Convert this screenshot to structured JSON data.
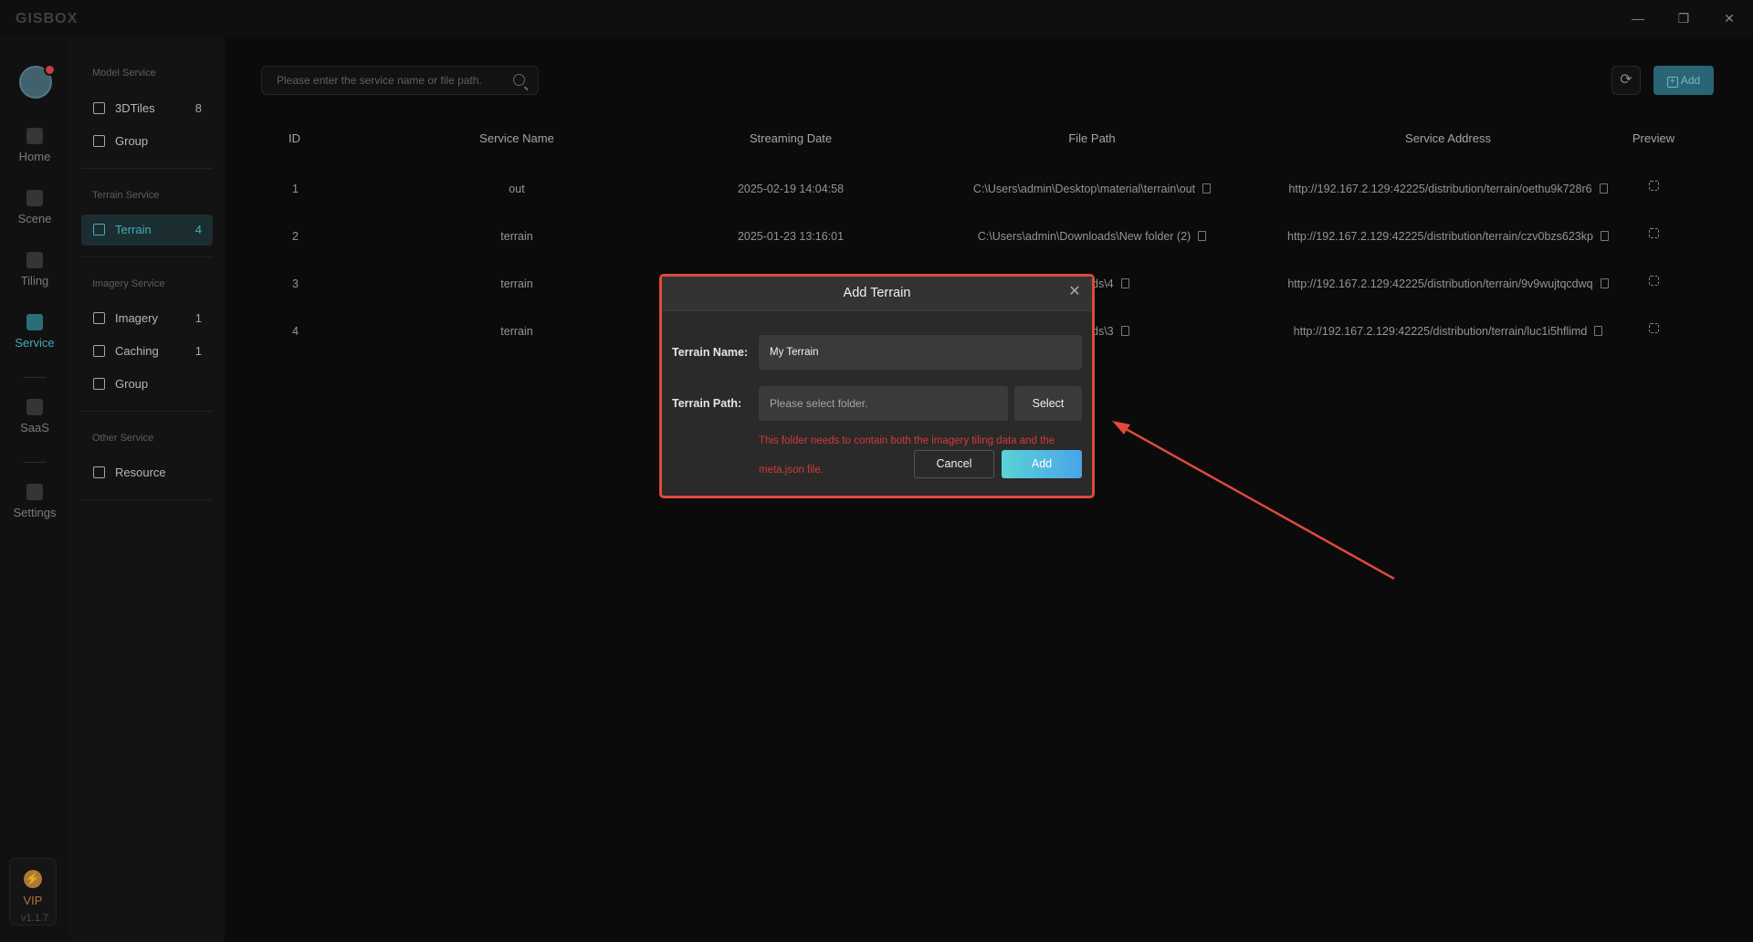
{
  "app": {
    "logo": "GISBOX",
    "version": "v1.1.7"
  },
  "rail": {
    "items": [
      {
        "label": "Home",
        "icon": "home-icon"
      },
      {
        "label": "Scene",
        "icon": "scene-icon"
      },
      {
        "label": "Tiling",
        "icon": "tiling-icon"
      },
      {
        "label": "Service",
        "icon": "service-icon",
        "active": true
      },
      {
        "label": "SaaS",
        "icon": "saas-icon"
      },
      {
        "label": "Settings",
        "icon": "settings-icon"
      }
    ],
    "vip_label": "VIP"
  },
  "sidebar": {
    "sections": [
      {
        "title": "Model Service",
        "items": [
          {
            "label": "3DTiles",
            "count": "8"
          },
          {
            "label": "Group",
            "count": ""
          }
        ]
      },
      {
        "title": "Terrain Service",
        "items": [
          {
            "label": "Terrain",
            "count": "4",
            "active": true
          }
        ]
      },
      {
        "title": "Imagery Service",
        "items": [
          {
            "label": "Imagery",
            "count": "1"
          },
          {
            "label": "Caching",
            "count": "1"
          },
          {
            "label": "Group",
            "count": ""
          }
        ]
      },
      {
        "title": "Other Service",
        "items": [
          {
            "label": "Resource",
            "count": ""
          }
        ]
      }
    ]
  },
  "toolbar": {
    "search_placeholder": "Please enter the service name or file path.",
    "add_label": "Add"
  },
  "table": {
    "headers": [
      "ID",
      "Service Name",
      "Streaming Date",
      "File Path",
      "Service Address",
      "Preview"
    ],
    "rows": [
      {
        "id": "1",
        "name": "out",
        "date": "2025-02-19 14:04:58",
        "path": "C:\\Users\\admin\\Desktop\\material\\terrain\\out",
        "address": "http://192.167.2.129:42225/distribution/terrain/oethu9k728r6"
      },
      {
        "id": "2",
        "name": "terrain",
        "date": "2025-01-23 13:16:01",
        "path": "C:\\Users\\admin\\Downloads\\New folder (2)",
        "address": "http://192.167.2.129:42225/distribution/terrain/czv0bzs623kp"
      },
      {
        "id": "3",
        "name": "terrain",
        "date": "",
        "path": "ds\\4",
        "address": "http://192.167.2.129:42225/distribution/terrain/9v9wujtqcdwq"
      },
      {
        "id": "4",
        "name": "terrain",
        "date": "",
        "path": "ds\\3",
        "address": "http://192.167.2.129:42225/distribution/terrain/luc1i5hflimd"
      }
    ]
  },
  "modal": {
    "title": "Add Terrain",
    "name_label": "Terrain Name:",
    "name_value": "My Terrain",
    "path_label": "Terrain Path:",
    "path_placeholder": "Please select folder.",
    "select_label": "Select",
    "hint": "This folder needs to contain both the imagery tiling data and the meta.json file.",
    "cancel_label": "Cancel",
    "confirm_label": "Add"
  },
  "colors": {
    "accent": "#4fc3d0",
    "highlight": "#e0493c",
    "error": "#d23a35"
  }
}
